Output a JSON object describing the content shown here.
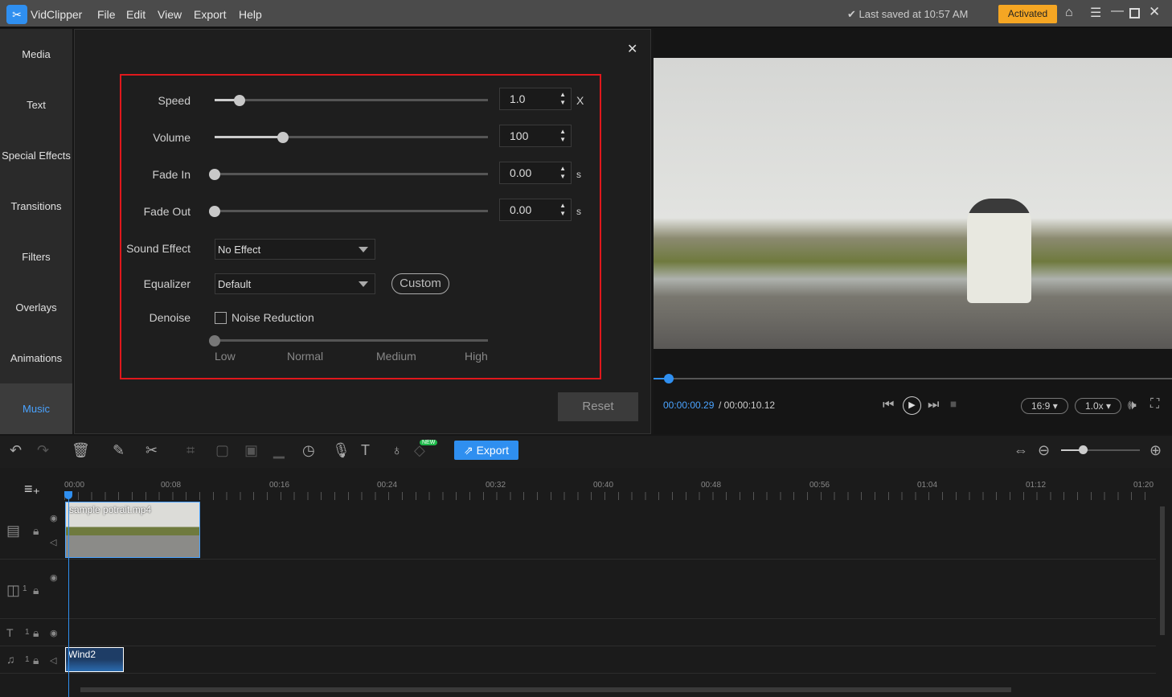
{
  "app": {
    "name": "VidClipper",
    "menu": [
      "File",
      "Edit",
      "View",
      "Export",
      "Help"
    ],
    "saved": "Last saved at 10:57 AM",
    "activated": "Activated"
  },
  "sidebar": {
    "items": [
      "Media",
      "Text",
      "Special Effects",
      "Transitions",
      "Filters",
      "Overlays",
      "Animations",
      "Music"
    ],
    "active": "Music"
  },
  "panel": {
    "speed": {
      "label": "Speed",
      "value": "1.0",
      "unit": "X",
      "level": 0.09
    },
    "volume": {
      "label": "Volume",
      "value": "100",
      "level": 0.25
    },
    "fade_in": {
      "label": "Fade In",
      "value": "0.00",
      "unit": "s",
      "level": 0
    },
    "fade_out": {
      "label": "Fade Out",
      "value": "0.00",
      "unit": "s",
      "level": 0
    },
    "sound_effect": {
      "label": "Sound Effect",
      "value": "No Effect"
    },
    "equalizer": {
      "label": "Equalizer",
      "value": "Default",
      "custom": "Custom"
    },
    "denoise": {
      "label": "Denoise",
      "checkbox": "Noise Reduction",
      "checked": false,
      "levels": [
        "Low",
        "Normal",
        "Medium",
        "High"
      ],
      "level": 0
    },
    "reset": "Reset"
  },
  "preview": {
    "current": "00:00:00.29",
    "total": "/ 00:00:10.12",
    "ratio": "16:9",
    "speed": "1.0x",
    "progress": 0.03
  },
  "toolbar": {
    "export": "Export",
    "new_badge": "NEW"
  },
  "timeline": {
    "ticks": [
      "00:00",
      "00:08",
      "00:16",
      "00:24",
      "00:32",
      "00:40",
      "00:48",
      "00:56",
      "01:04",
      "01:12",
      "01:20"
    ],
    "video_clip": "sample potrait.mp4",
    "audio_clip": "Wind2",
    "track_num": "1"
  }
}
